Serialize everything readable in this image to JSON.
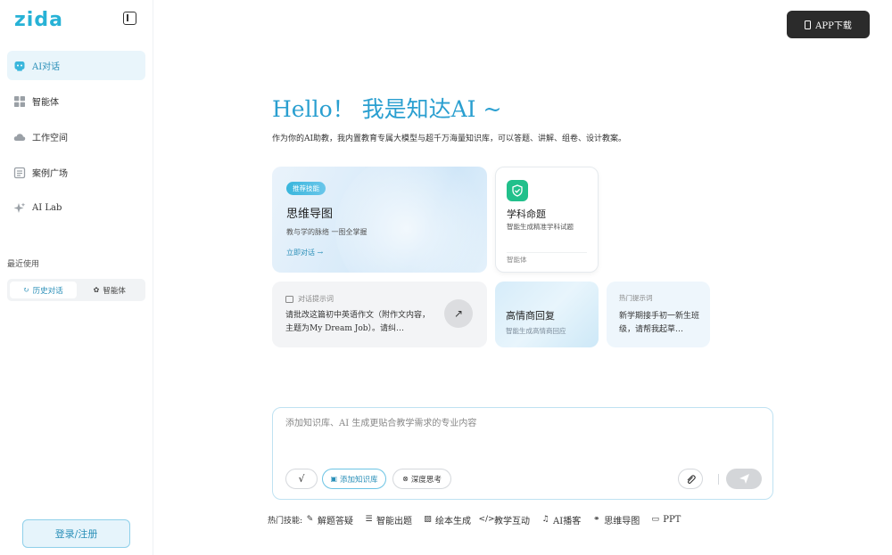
{
  "brand": {
    "logo_text": "zida",
    "accent": "#27b2d6"
  },
  "sidebar": {
    "items": [
      {
        "label": "AI对话",
        "icon": "chat-bot-icon",
        "active": true
      },
      {
        "label": "智能体",
        "icon": "grid-icon",
        "active": false
      },
      {
        "label": "工作空间",
        "icon": "cloud-icon",
        "active": false
      },
      {
        "label": "案例广场",
        "icon": "list-doc-icon",
        "active": false
      },
      {
        "label": "AI Lab",
        "icon": "sparkle-icon",
        "active": false
      }
    ],
    "recent_label": "最近使用",
    "segment": [
      {
        "label": "历史对话",
        "icon": "history-icon",
        "active": true
      },
      {
        "label": "智能体",
        "icon": "gear-icon",
        "active": false
      }
    ],
    "login_label": "登录/注册"
  },
  "header": {
    "app_download_label": "APP下载"
  },
  "hero": {
    "title": "Hello！ 我是知达AI ~",
    "subtitle": "作为你的AI助教，我内置教育专属大模型与超千万海量知识库，可以答题、讲解、组卷、设计教案。"
  },
  "cards": {
    "mindmap": {
      "badge": "推荐技能",
      "title": "思维导图",
      "desc": "教与学的脉络 一图全掌握",
      "link": "立即对话 →"
    },
    "subject": {
      "title": "学科命题",
      "desc": "智能生成精准学科试题",
      "tag": "智能体"
    },
    "prompt": {
      "head": "对话提示词",
      "text": "请批改这篇初中英语作文（附作文内容，主题为My Dream Job）。请纠…"
    },
    "eq": {
      "title": "高情商回复",
      "desc": "智能生成高情商回应"
    },
    "hot": {
      "head": "热门提示词",
      "text": "新学期接手初一新生班级，请帮我起草…"
    }
  },
  "input": {
    "placeholder": "添加知识库、AI 生成更贴合教学需求的专业内容",
    "check_label": "√",
    "kb_label": "添加知识库",
    "think_label": "深度思考"
  },
  "skills": {
    "label": "热门技能:",
    "items": [
      {
        "label": "解题答疑",
        "icon": "solve-icon"
      },
      {
        "label": "智能出题",
        "icon": "quiz-icon"
      },
      {
        "label": "绘本生成",
        "icon": "picture-book-icon"
      },
      {
        "label": "教学互动",
        "icon": "code-icon"
      },
      {
        "label": "AI播客",
        "icon": "microphone-icon"
      },
      {
        "label": "思维导图",
        "icon": "mindmap-icon"
      },
      {
        "label": "PPT",
        "icon": "presentation-icon"
      }
    ]
  }
}
